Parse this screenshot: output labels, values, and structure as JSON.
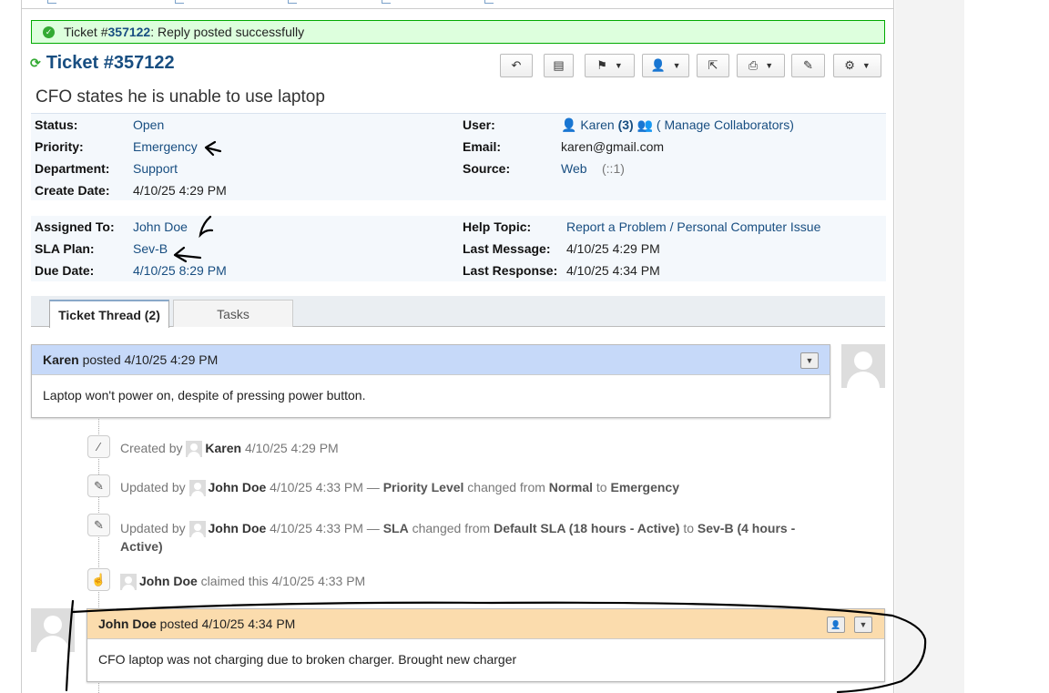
{
  "notice": {
    "prefix": "Ticket #",
    "number": "357122",
    "suffix": ": Reply posted successfully"
  },
  "ticket": {
    "title": "Ticket #357122",
    "subject": "CFO states he is unable to use laptop"
  },
  "toolbar": {
    "icons": [
      "reply-icon",
      "print-icon",
      "flag-icon",
      "user-icon",
      "share-icon",
      "printer-icon",
      "edit-icon",
      "gear-icon"
    ]
  },
  "info1": {
    "status_label": "Status:",
    "status": "Open",
    "priority_label": "Priority:",
    "priority": "Emergency",
    "department_label": "Department:",
    "department": "Support",
    "created_label": "Create Date:",
    "created": "4/10/25 4:29 PM",
    "user_label": "User:",
    "user": "Karen",
    "user_count": "(3)",
    "collab": "( Manage Collaborators)",
    "email_label": "Email:",
    "email": "karen@gmail.com",
    "source_label": "Source:",
    "source": "Web",
    "source_ip": "(::1)"
  },
  "info2": {
    "assigned_label": "Assigned To:",
    "assigned": "John Doe",
    "sla_label": "SLA Plan:",
    "sla": "Sev-B",
    "due_label": "Due Date:",
    "due": "4/10/25 8:29 PM",
    "topic_label": "Help Topic:",
    "topic": "Report a Problem / Personal Computer Issue",
    "lastmsg_label": "Last Message:",
    "lastmsg": "4/10/25 4:29 PM",
    "lastresp_label": "Last Response:",
    "lastresp": "4/10/25 4:34 PM"
  },
  "tabs": {
    "thread": "Ticket Thread (2)",
    "tasks": "Tasks"
  },
  "thread": {
    "msg1": {
      "author": "Karen",
      "posted": "posted",
      "time": "4/10/25 4:29 PM",
      "body": "Laptop won't power on, despite of pressing power button."
    },
    "events": [
      {
        "verb": "Created by",
        "who": "Karen",
        "time": "4/10/25 4:29 PM"
      },
      {
        "verb": "Updated by",
        "who": "John Doe",
        "time": "4/10/25 4:33 PM —",
        "field": "Priority Level",
        "mid": "changed from",
        "from": "Normal",
        "to_word": "to",
        "to": "Emergency"
      },
      {
        "verb": "Updated by",
        "who": "John Doe",
        "time": "4/10/25 4:33 PM —",
        "field": "SLA",
        "mid": "changed from",
        "from": "Default SLA (18 hours - Active)",
        "to_word": "to",
        "to": "Sev-B (4 hours - Active)"
      },
      {
        "who": "John Doe",
        "verb": "claimed this",
        "time": "4/10/25 4:33 PM"
      }
    ],
    "msg2": {
      "author": "John Doe",
      "posted": "posted",
      "time": "4/10/25 4:34 PM",
      "body": "CFO laptop was not charging due to broken charger. Brought new charger"
    }
  },
  "colors": {
    "link": "#184e81",
    "notice_bg": "#ddffdd",
    "user_header": "#c6d9f9",
    "staff_header": "#fbdcad"
  }
}
